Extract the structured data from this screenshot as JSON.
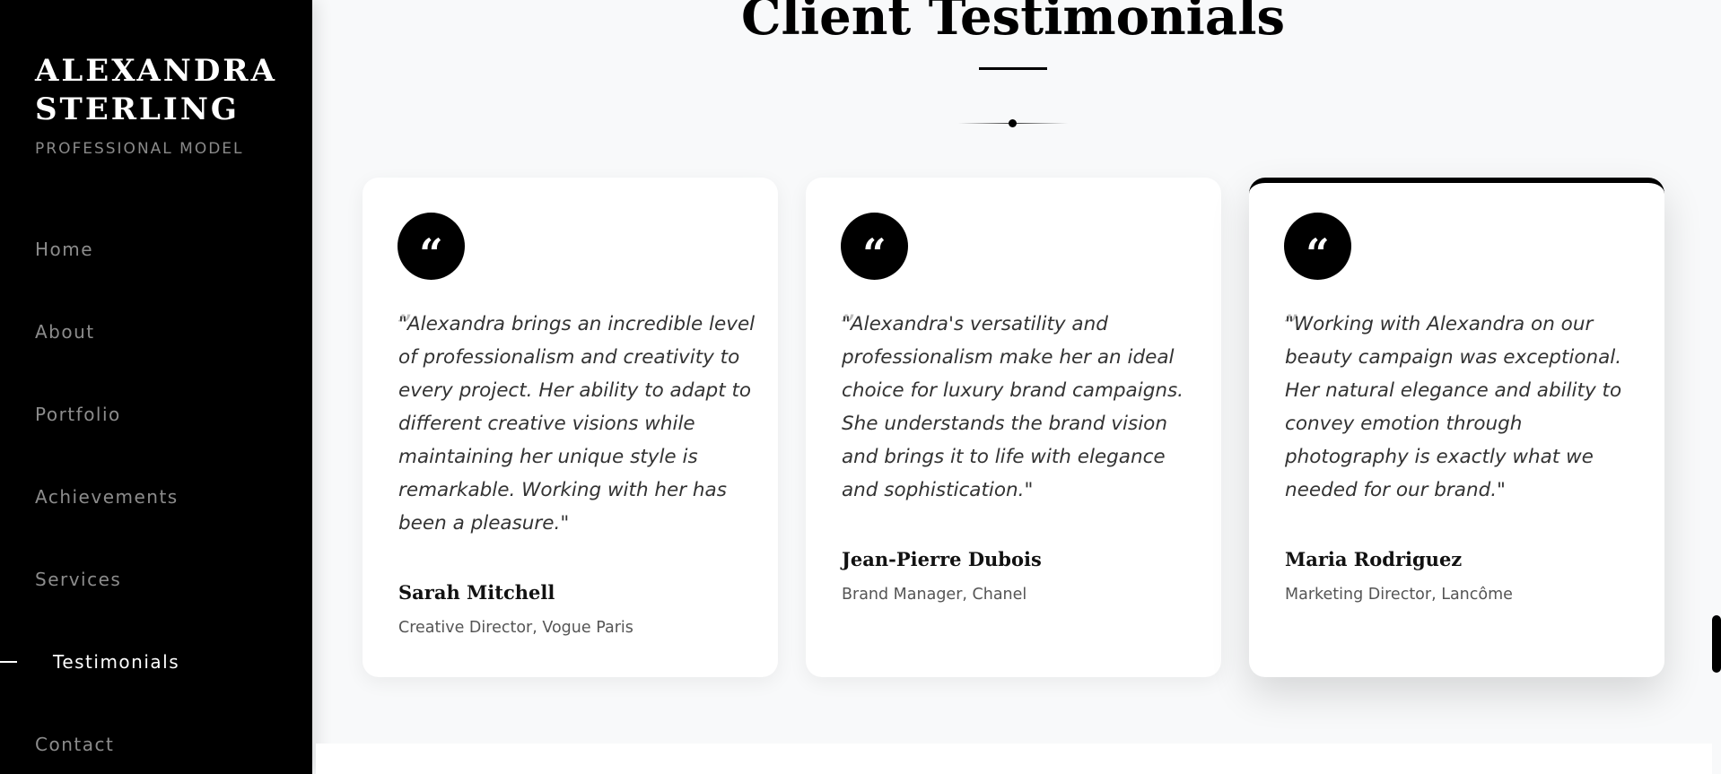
{
  "sidebar": {
    "brand_line1": "ALEXANDRA",
    "brand_line2": "STERLING",
    "tagline": "PROFESSIONAL MODEL",
    "nav": [
      {
        "label": "Home"
      },
      {
        "label": "About"
      },
      {
        "label": "Portfolio"
      },
      {
        "label": "Achievements"
      },
      {
        "label": "Services"
      },
      {
        "label": "Testimonials",
        "active": true
      },
      {
        "label": "Contact"
      }
    ]
  },
  "section": {
    "title": "Client Testimonials"
  },
  "testimonials": [
    {
      "quote": "\"Alexandra brings an incredible level of professionalism and creativity to every project. Her ability to adapt to different creative visions while maintaining her unique style is remarkable. Working with her has been a pleasure.\"",
      "author": "Sarah Mitchell",
      "role": "Creative Director, Vogue Paris"
    },
    {
      "quote": "\"Alexandra's versatility and professionalism make her an ideal choice for luxury brand campaigns. She understands the brand vision and brings it to life with elegance and sophistication.\"",
      "author": "Jean-Pierre Dubois",
      "role": "Brand Manager, Chanel"
    },
    {
      "quote": "\"Working with Alexandra on our beauty campaign was exceptional. Her natural elegance and ability to convey emotion through photography is exactly what we needed for our brand.\"",
      "author": "Maria Rodriguez",
      "role": "Marketing Director, Lancôme"
    }
  ],
  "icons": {
    "quote": "quote-icon"
  },
  "colors": {
    "sidebar_bg": "#000000",
    "page_bg": "#f8f9fa",
    "card_bg": "#ffffff",
    "accent": "#000000"
  }
}
